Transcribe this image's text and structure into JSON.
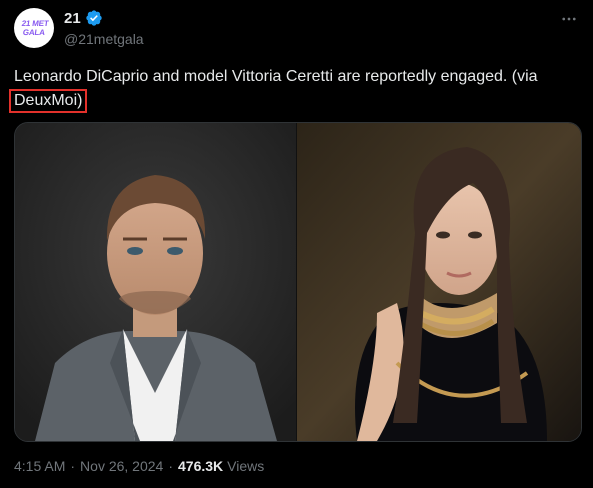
{
  "author": {
    "display_name": "21",
    "handle": "@21metgala",
    "avatar_text_line1": "21 MET",
    "avatar_text_line2": "GALA",
    "verified": true
  },
  "tweet": {
    "text_main": "Leonardo DiCaprio and model Vittoria Ceretti are reportedly engaged. (via",
    "text_highlighted": "DeuxMoi)"
  },
  "media": {
    "images": [
      "portrait-man",
      "portrait-woman"
    ]
  },
  "meta": {
    "time": "4:15 AM",
    "separator": "·",
    "date": "Nov 26, 2024",
    "views_count": "476.3K",
    "views_label": "Views"
  },
  "colors": {
    "background": "#000000",
    "text": "#e7e9ea",
    "muted": "#71767b",
    "verified": "#1d9bf0",
    "highlight_box": "#e3312b"
  },
  "icons": {
    "verified": "verified-badge-icon",
    "more": "more-horizontal-icon"
  }
}
